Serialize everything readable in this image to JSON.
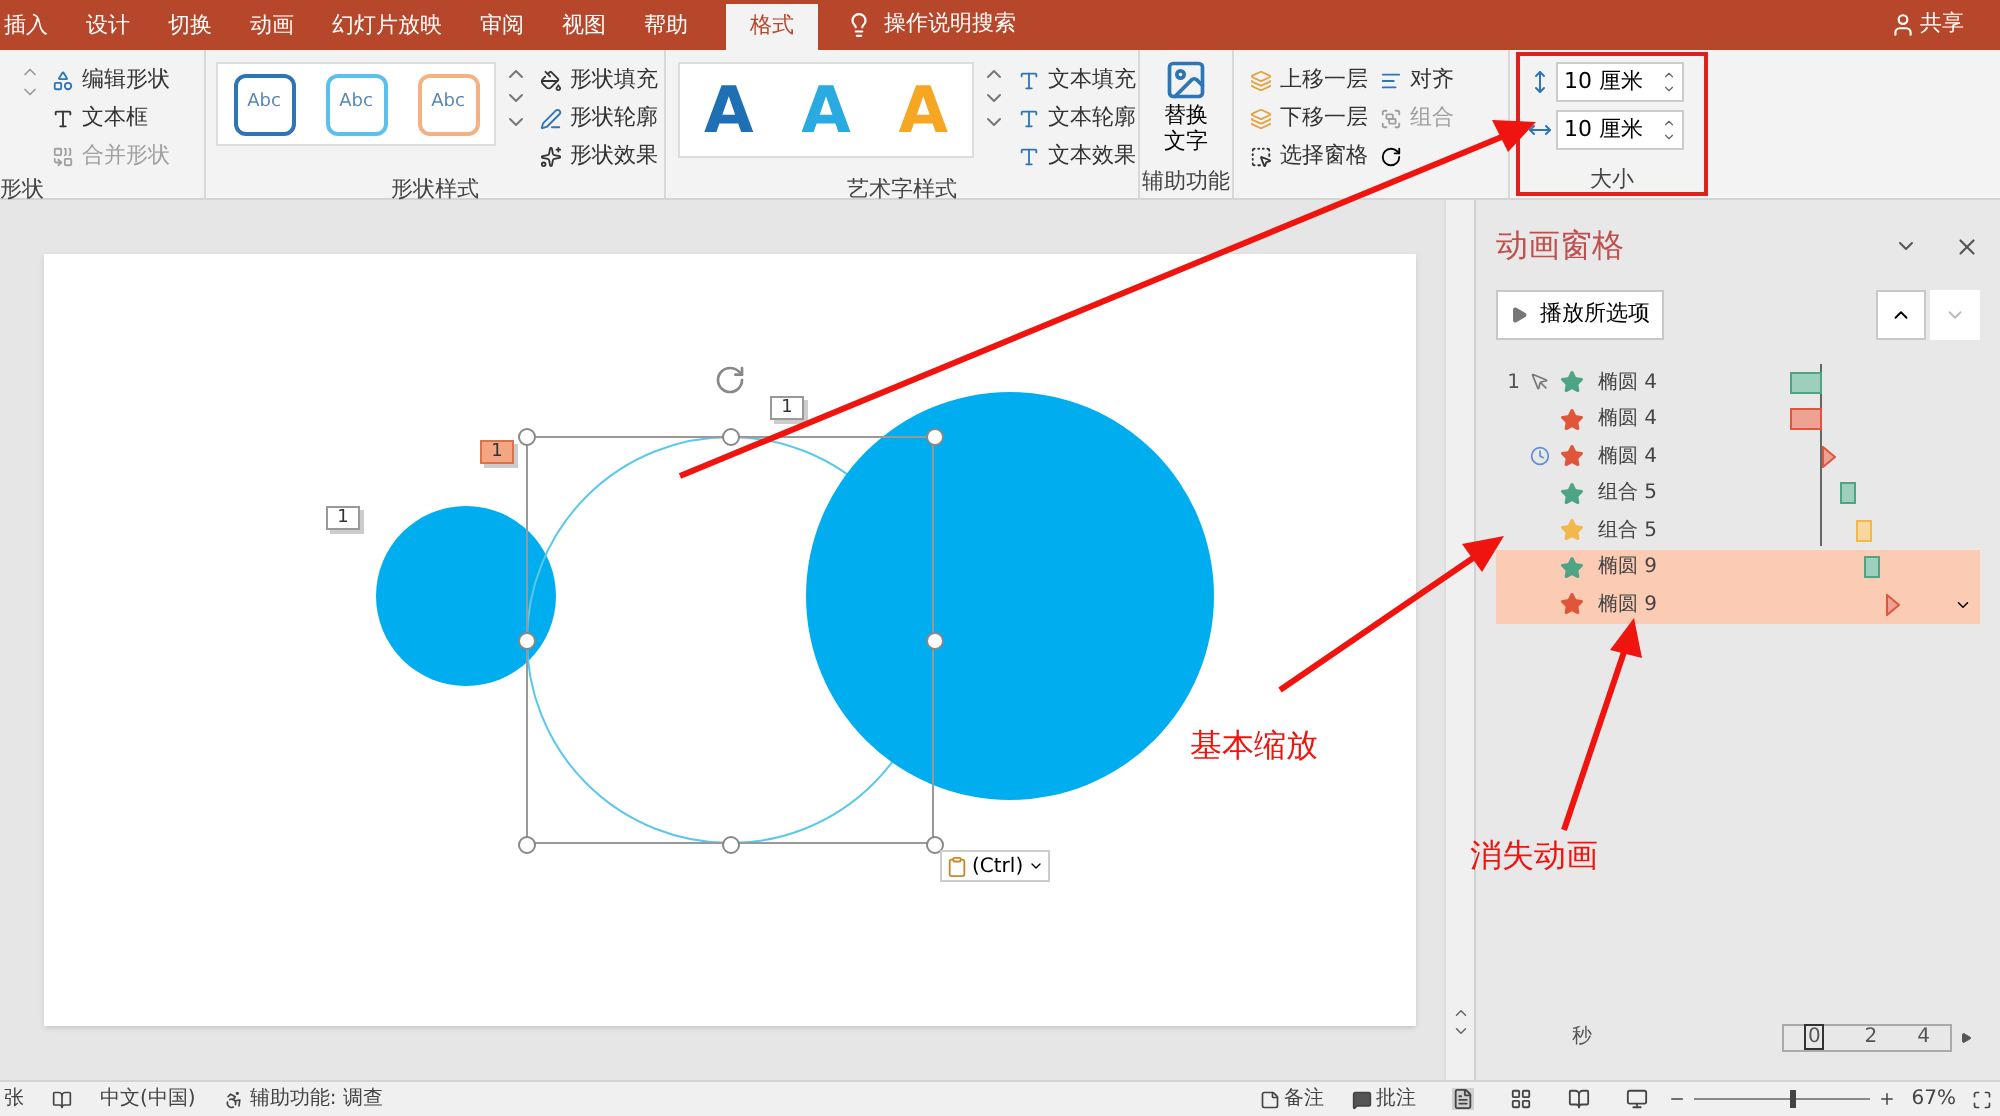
{
  "ribbon_tabs": [
    {
      "label": "插入",
      "selected": false
    },
    {
      "label": "设计",
      "selected": false
    },
    {
      "label": "切换",
      "selected": false
    },
    {
      "label": "动画",
      "selected": false
    },
    {
      "label": "幻灯片放映",
      "selected": false
    },
    {
      "label": "审阅",
      "selected": false
    },
    {
      "label": "视图",
      "selected": false
    },
    {
      "label": "帮助",
      "selected": false
    },
    {
      "label": "格式",
      "selected": true
    }
  ],
  "tell_me": "操作说明搜索",
  "share": "共享",
  "insert_shapes": {
    "label": "形状",
    "items": [
      {
        "label": "编辑形状",
        "disabled": false
      },
      {
        "label": "文本框",
        "disabled": false
      },
      {
        "label": "合并形状",
        "disabled": true
      }
    ]
  },
  "shape_styles": {
    "label": "形状样式",
    "swatches": [
      {
        "text": "Abc",
        "color": "#2e75b6"
      },
      {
        "text": "Abc",
        "color": "#5bc0eb"
      },
      {
        "text": "Abc",
        "color": "#f4b183"
      }
    ],
    "commands": [
      "形状填充",
      "形状轮廓",
      "形状效果"
    ]
  },
  "wordart_styles": {
    "label": "艺术字样式",
    "samples": [
      {
        "text": "A",
        "color": "#1f6fb5"
      },
      {
        "text": "A",
        "color": "#29abe2"
      },
      {
        "text": "A",
        "color": "#f5a623"
      }
    ],
    "commands": [
      "文本填充",
      "文本轮廓",
      "文本效果"
    ]
  },
  "accessibility": {
    "label": "辅助功能",
    "button": "替换文字"
  },
  "arrange": {
    "items": [
      {
        "label": "上移一层",
        "disabled": false
      },
      {
        "label": "下移一层",
        "disabled": false
      },
      {
        "label": "选择窗格",
        "disabled": false
      },
      {
        "label": "对齐",
        "disabled": false
      },
      {
        "label": "组合",
        "disabled": true
      }
    ]
  },
  "size": {
    "label": "大小",
    "height": "10 厘米",
    "width": "10 厘米"
  },
  "slide": {
    "tags": [
      {
        "text": "1",
        "highlighted": false
      },
      {
        "text": "1",
        "highlighted": true
      },
      {
        "text": "1",
        "highlighted": false
      }
    ],
    "paste_options": "(Ctrl)"
  },
  "animation_pane": {
    "title": "动画窗格",
    "play_button": "播放所选项",
    "items": [
      {
        "order": "1",
        "kind": "click",
        "color": "#4ea585",
        "name": "椭圆 4",
        "instant": false,
        "selected": false
      },
      {
        "kind": "with",
        "color": "#e0563a",
        "name": "椭圆 4",
        "instant": false,
        "selected": false
      },
      {
        "kind": "after",
        "color": "#e0563a",
        "name": "椭圆 4",
        "instant": true,
        "selected": false
      },
      {
        "kind": "with",
        "color": "#4ea585",
        "name": "组合 5",
        "instant": false,
        "selected": false
      },
      {
        "kind": "with",
        "color": "#f2b84b",
        "name": "组合 5",
        "instant": false,
        "selected": false
      },
      {
        "kind": "with",
        "color": "#4ea585",
        "name": "椭圆 9",
        "instant": false,
        "selected": true
      },
      {
        "kind": "with",
        "color": "#e0563a",
        "name": "椭圆 9",
        "instant": true,
        "selected": true
      }
    ],
    "timeline": {
      "unit": "秒",
      "ticks": [
        "0",
        "2",
        "4"
      ]
    }
  },
  "annotations": [
    "基本缩放",
    "消失动画"
  ],
  "status_bar": {
    "slide": "张",
    "language": "中文(中国)",
    "accessibility": "辅助功能: 调查",
    "notes": "备注",
    "comments": "批注",
    "zoom": {
      "level": 0.55,
      "reading": "67%"
    }
  }
}
